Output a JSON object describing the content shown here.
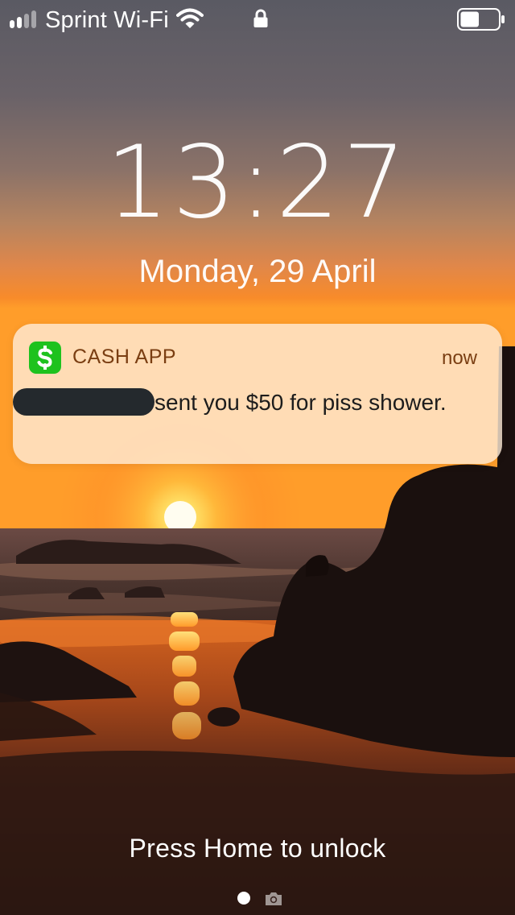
{
  "status_bar": {
    "carrier": "Sprint Wi-Fi",
    "signal_bars": 2,
    "signal_bars_total": 4,
    "battery_level": 0.5,
    "icons": [
      "signal-icon",
      "wifi-icon",
      "lock-icon",
      "battery-icon"
    ]
  },
  "lock_screen": {
    "time": "13:27",
    "date": "Monday, 29 April",
    "unlock_hint": "Press Home to unlock"
  },
  "notification": {
    "app_name": "CASH APP",
    "app_icon": "cash-app-icon",
    "time": "now",
    "message": "sent you $50 for piss shower.",
    "sender_redacted": true
  },
  "page_indicator": {
    "icons": [
      "page-dot",
      "camera-icon"
    ]
  },
  "colors": {
    "notification_background": "#FFECD8",
    "app_name_text": "#7A3E12",
    "cash_app_green": "#1EC21E",
    "redaction": "#24292D"
  }
}
